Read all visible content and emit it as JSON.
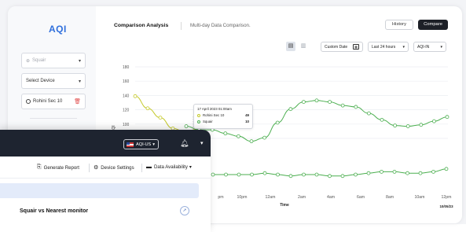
{
  "back_window": {
    "sidebar": {
      "logo": "AQI",
      "location_select": {
        "label": "Squair",
        "icon": "pin-icon"
      },
      "device_select": {
        "label": "Select Device"
      },
      "device_chip": {
        "label": "Rohini Sec 10"
      }
    },
    "header": {
      "title": "Comparison Analysis",
      "subtitle": "Multi-day Data Comparison.",
      "history_label": "History",
      "compare_label": "Compare"
    },
    "toolbar": {
      "view_line_icon": "line-chart-icon",
      "view_bar_icon": "bar-chart-icon",
      "custom_date_label": "Custom Date",
      "range_label": "Last 24 hours",
      "metric_label": "AQI-IN"
    },
    "tooltip": {
      "timestamp": "17 April 2023   01:00am",
      "rows": [
        {
          "name": "Rohini Sec 10",
          "value": "49",
          "color": "#c4c92a"
        },
        {
          "name": "Squair",
          "value": "10",
          "color": "#4caf50"
        }
      ]
    },
    "chart_data": {
      "type": "line",
      "ylabel": "AQI",
      "xlabel": "Time",
      "ylim": [
        0,
        180
      ],
      "y_ticks": [
        "180",
        "160",
        "140",
        "120",
        "100",
        "80"
      ],
      "x_tick_labels": [
        "10pm",
        "12am",
        "2am",
        "4am",
        "6am",
        "8am",
        "10am",
        "12pm"
      ],
      "x_extra_label": "pm",
      "date_label": "10/05/23",
      "grid": true,
      "series": [
        {
          "name": "Rohini Sec 10",
          "color": "#c4c92a",
          "values": [
            139,
            122,
            109,
            94,
            89,
            93
          ]
        },
        {
          "name": "Squair",
          "color": "#4caf50",
          "values": [
            97,
            92,
            92,
            87,
            83,
            76,
            81,
            102,
            121,
            131,
            133,
            131,
            126,
            124,
            115,
            106,
            98,
            97,
            99,
            104,
            110
          ]
        },
        {
          "name": "Squair",
          "color": "#4caf50",
          "values": [
            40,
            40,
            40,
            40,
            41,
            40,
            39,
            40,
            40,
            39,
            39,
            40,
            41,
            42,
            42,
            41,
            41,
            42,
            44
          ]
        }
      ]
    }
  },
  "front_window": {
    "topbar": {
      "aqi_label": "AQI-US",
      "bell_icon": "bell-icon",
      "chevron_icon": "chevron-down-icon"
    },
    "actions": {
      "report_label": "Generate Report",
      "settings_label": "Device Settings",
      "availability_label": "Data Availability"
    },
    "card": {
      "title": "Squair vs Nearest monitor",
      "icon": "rocket-icon"
    }
  }
}
